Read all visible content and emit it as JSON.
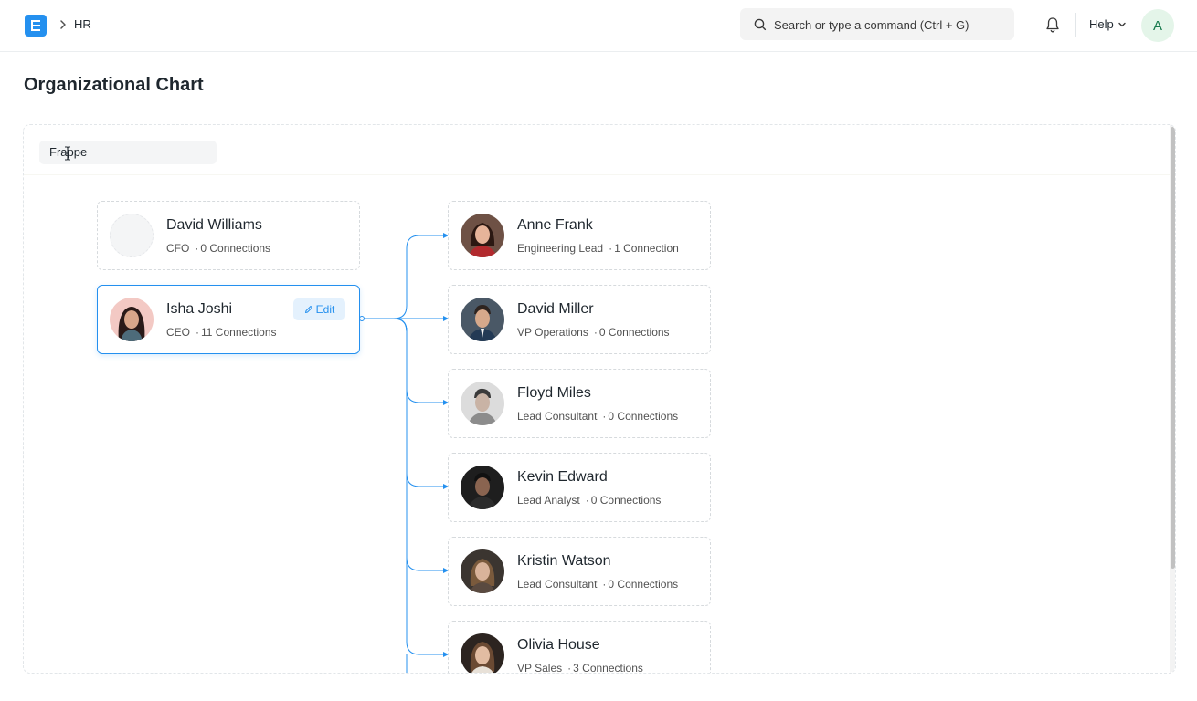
{
  "navbar": {
    "breadcrumb": "HR",
    "search_placeholder": "Search or type a command (Ctrl + G)",
    "help_label": "Help",
    "user_initial": "A"
  },
  "page": {
    "title": "Organizational Chart"
  },
  "company_filter": {
    "value": "Frappe"
  },
  "colors": {
    "accent": "#2490ef",
    "connector": "#2490ef",
    "avatar_bg": "#e4f5e9"
  },
  "root_nodes": [
    {
      "name": "David Williams",
      "designation": "CFO",
      "connections": "0 Connections",
      "active": false,
      "has_photo": false
    },
    {
      "name": "Isha Joshi",
      "designation": "CEO",
      "connections": "11 Connections",
      "active": true,
      "has_photo": true,
      "edit_label": "Edit"
    }
  ],
  "child_nodes": [
    {
      "name": "Anne Frank",
      "designation": "Engineering Lead",
      "connections": "1 Connection"
    },
    {
      "name": "David Miller",
      "designation": "VP Operations",
      "connections": "0 Connections"
    },
    {
      "name": "Floyd Miles",
      "designation": "Lead Consultant",
      "connections": "0 Connections"
    },
    {
      "name": "Kevin Edward",
      "designation": "Lead Analyst",
      "connections": "0 Connections"
    },
    {
      "name": "Kristin Watson",
      "designation": "Lead Consultant",
      "connections": "0 Connections"
    },
    {
      "name": "Olivia House",
      "designation": "VP Sales",
      "connections": "3 Connections"
    }
  ]
}
